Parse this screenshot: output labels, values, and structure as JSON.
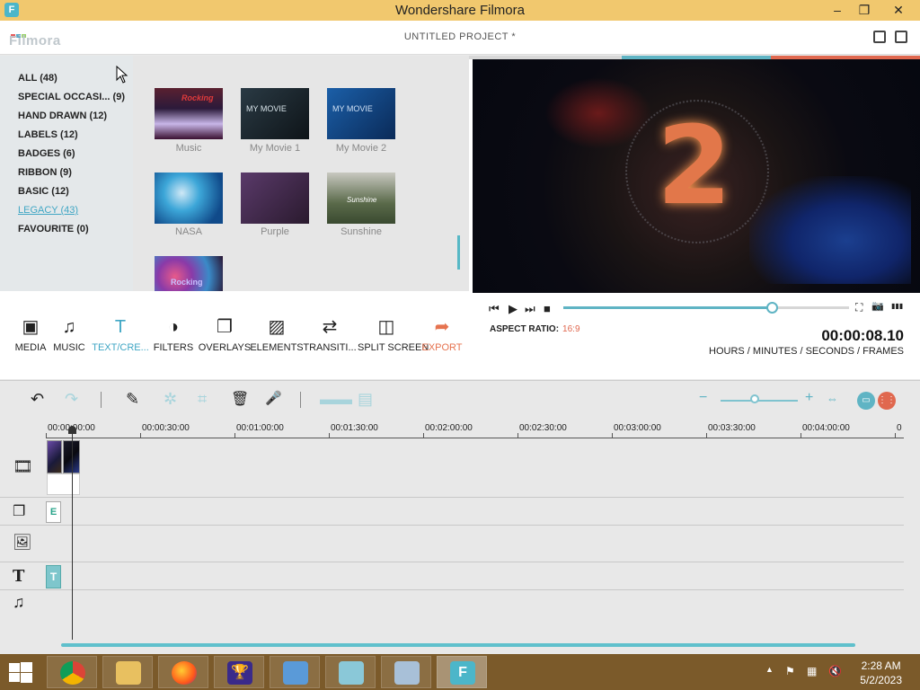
{
  "window": {
    "title": "Wondershare Filmora",
    "app_icon": "F",
    "minimize": "–",
    "restore": "❐",
    "close": "✕"
  },
  "header": {
    "logo": "Filmora",
    "project_title": "UNTITLED PROJECT *"
  },
  "categories": [
    {
      "label": "ALL (48)"
    },
    {
      "label": "SPECIAL OCCASI...  (9)"
    },
    {
      "label": "HAND DRAWN (12)"
    },
    {
      "label": "LABELS (12)"
    },
    {
      "label": "BADGES (6)"
    },
    {
      "label": "RIBBON (9)"
    },
    {
      "label": "BASIC (12)"
    },
    {
      "label": "LEGACY (43)",
      "active": true
    },
    {
      "label": "FAVOURITE (0)"
    }
  ],
  "library": {
    "items": [
      {
        "label": "Music",
        "overlay": "Rocking"
      },
      {
        "label": "My Movie 1",
        "overlay": "MY MOVIE"
      },
      {
        "label": "My Movie 2",
        "overlay": "MY MOVIE"
      },
      {
        "label": "NASA",
        "overlay": ""
      },
      {
        "label": "Purple",
        "overlay": ""
      },
      {
        "label": "Sunshine",
        "overlay": "Sunshine"
      },
      {
        "label": "",
        "overlay": "Rocking"
      }
    ]
  },
  "preview": {
    "countdown_digit": "2"
  },
  "player": {
    "rewind": "⏮",
    "play": "▶",
    "forward": "⏭",
    "stop": "■",
    "progress": 0.73,
    "aspect_label": "ASPECT RATIO:",
    "aspect_value": "16:9",
    "timecode": "00:00:08.10",
    "time_units": "HOURS / MINUTES / SECONDS / FRAMES",
    "fullscreen": "⛶",
    "snapshot": "📷",
    "volume": "▮▮▮"
  },
  "toolbar": {
    "tools": [
      {
        "name": "media",
        "label": "MEDIA",
        "icon": "▣"
      },
      {
        "name": "music",
        "label": "MUSIC",
        "icon": "♫"
      },
      {
        "name": "text",
        "label": "TEXT/CRE...",
        "icon": "T",
        "active": true
      },
      {
        "name": "filters",
        "label": "FILTERS",
        "icon": "◑"
      },
      {
        "name": "overlays",
        "label": "OVERLAYS",
        "icon": "❐"
      },
      {
        "name": "elements",
        "label": "ELEMENTS",
        "icon": "▨"
      },
      {
        "name": "transitions",
        "label": "TRANSITI...",
        "icon": "⇄"
      },
      {
        "name": "split-screen",
        "label": "SPLIT SCREEN",
        "icon": "◫"
      },
      {
        "name": "export",
        "label": "EXPORT",
        "icon": "➦"
      }
    ]
  },
  "timeline": {
    "undo": "↶",
    "redo": "↷",
    "edit": "✎",
    "crop": "⌗",
    "delete": "🗑",
    "voice": "🎤",
    "zoom_out": "−",
    "zoom_in": "+",
    "ruler": [
      "00:00:00:00",
      "00:00:30:00",
      "00:01:00:00",
      "00:01:30:00",
      "00:02:00:00",
      "00:02:30:00",
      "00:03:00:00",
      "00:03:30:00",
      "00:04:00:00",
      "0"
    ],
    "tracks": {
      "element_clip": "E",
      "text_clip": "T"
    }
  },
  "taskbar": {
    "apps": [
      "chrome",
      "file-explorer",
      "firefox",
      "trophy",
      "control-panel",
      "notepad",
      "resource-monitor",
      "filmora"
    ],
    "filmora_glyph": "F",
    "time": "2:28 AM",
    "date": "5/2/2023"
  },
  "colors": {
    "accent": "#3fa6c4",
    "export": "#e6734f",
    "titlebar": "#f1c86e",
    "taskbar": "#7b5a2a"
  }
}
